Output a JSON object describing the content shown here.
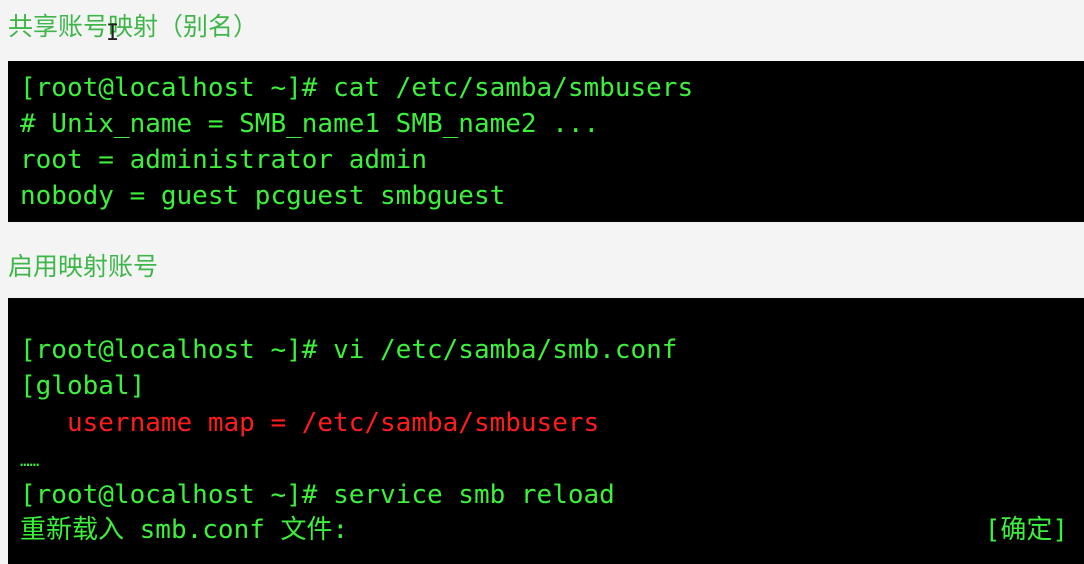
{
  "colors": {
    "heading": "#3fb64a",
    "terminal_bg": "#000000",
    "terminal_text": "#3cf03c",
    "highlight": "#ff1c1c",
    "page_bg": "#f4f4f4"
  },
  "section1": {
    "heading": "共享账号映射（别名）",
    "terminal": [
      "[root@localhost ~]# cat /etc/samba/smbusers",
      "# Unix_name = SMB_name1 SMB_name2 ...",
      "root = administrator admin",
      "nobody = guest pcguest smbguest"
    ]
  },
  "section2": {
    "heading": "启用映射账号",
    "terminal": {
      "command1": "[root@localhost ~]# vi /etc/samba/smb.conf",
      "section_header": "[global]",
      "highlight_line": "   username map = /etc/samba/smbusers",
      "ellipsis": "……",
      "command2": "[root@localhost ~]# service smb reload",
      "status_text": "重新载入 smb.conf 文件:",
      "status_result": "[确定]"
    }
  },
  "cursor": {
    "icon": "text-cursor-icon"
  }
}
